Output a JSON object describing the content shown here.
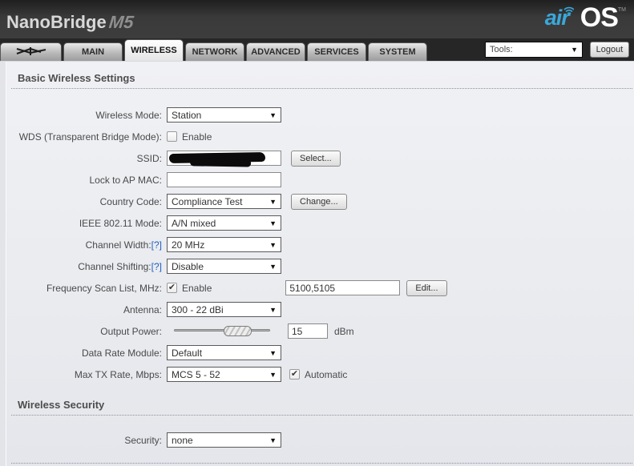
{
  "header": {
    "brand": "NanoBridge",
    "model": "M5",
    "logo_air": "air",
    "logo_os": "OS",
    "logo_tm": "TM"
  },
  "tabs": [
    {
      "icon": "antenna-icon",
      "label": "",
      "active": false
    },
    {
      "label": "MAIN",
      "active": false
    },
    {
      "label": "WIRELESS",
      "active": true
    },
    {
      "label": "NETWORK",
      "active": false
    },
    {
      "label": "ADVANCED",
      "active": false
    },
    {
      "label": "SERVICES",
      "active": false
    },
    {
      "label": "SYSTEM",
      "active": false
    }
  ],
  "toolbar": {
    "tools_label": "Tools:",
    "logout_label": "Logout"
  },
  "sections": {
    "basic_title": "Basic Wireless Settings",
    "security_title": "Wireless Security"
  },
  "fields": {
    "wireless_mode": {
      "label": "Wireless Mode:",
      "value": "Station"
    },
    "wds": {
      "label": "WDS (Transparent Bridge Mode):",
      "checkbox_label": "Enable",
      "checked": false
    },
    "ssid": {
      "label": "SSID:",
      "value": "",
      "redacted": true,
      "button": "Select..."
    },
    "lock_to_ap_mac": {
      "label": "Lock to AP MAC:",
      "value": ""
    },
    "country_code": {
      "label": "Country Code:",
      "value": "Compliance Test",
      "button": "Change..."
    },
    "ieee_mode": {
      "label": "IEEE 802.11 Mode:",
      "value": "A/N mixed"
    },
    "channel_width": {
      "label": "Channel Width:",
      "help": "[?]",
      "value": "20 MHz"
    },
    "channel_shifting": {
      "label": "Channel Shifting:",
      "help": "[?]",
      "value": "Disable"
    },
    "freq_scan": {
      "label": "Frequency Scan List, MHz:",
      "checkbox_label": "Enable",
      "checked": true,
      "value": "5100,5105",
      "button": "Edit..."
    },
    "antenna": {
      "label": "Antenna:",
      "value": "300 - 22 dBi"
    },
    "output_power": {
      "label": "Output Power:",
      "value": "15",
      "unit": "dBm",
      "slider_percent": 62
    },
    "data_rate_module": {
      "label": "Data Rate Module:",
      "value": "Default"
    },
    "max_tx_rate": {
      "label": "Max TX Rate, Mbps:",
      "value": "MCS 5 - 52",
      "checkbox_label": "Automatic",
      "checked": true
    },
    "security": {
      "label": "Security:",
      "value": "none"
    }
  },
  "colors": {
    "accent_blue": "#3aa8da",
    "help_link_blue": "#1f5fbf",
    "header_dark": "#3a3a3a"
  }
}
